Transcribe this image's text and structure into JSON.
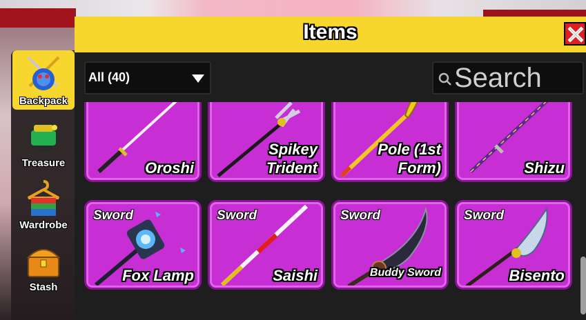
{
  "window": {
    "title": "Items",
    "close_icon": "close-icon"
  },
  "sidebar": {
    "items": [
      {
        "label": "Backpack",
        "icon": "backpack-icon",
        "active": true
      },
      {
        "label": "Treasure",
        "icon": "treasure-icon",
        "active": false
      },
      {
        "label": "Wardrobe",
        "icon": "wardrobe-icon",
        "active": false
      },
      {
        "label": "Stash",
        "icon": "stash-icon",
        "active": false
      }
    ]
  },
  "filter": {
    "selected": "All (40)"
  },
  "search": {
    "placeholder": "Search",
    "value": ""
  },
  "items": [
    {
      "type": "",
      "name": "Oroshi"
    },
    {
      "type": "",
      "name": "Spikey Trident"
    },
    {
      "type": "",
      "name": "Pole (1st Form)"
    },
    {
      "type": "",
      "name": "Shizu"
    },
    {
      "type": "Sword",
      "name": "Fox Lamp"
    },
    {
      "type": "Sword",
      "name": "Saishi"
    },
    {
      "type": "Sword",
      "name": "Buddy Sword"
    },
    {
      "type": "Sword",
      "name": "Bisento"
    }
  ],
  "colors": {
    "accent": "#f7d62e",
    "card": "#c72fd4",
    "close": "#e02020"
  }
}
